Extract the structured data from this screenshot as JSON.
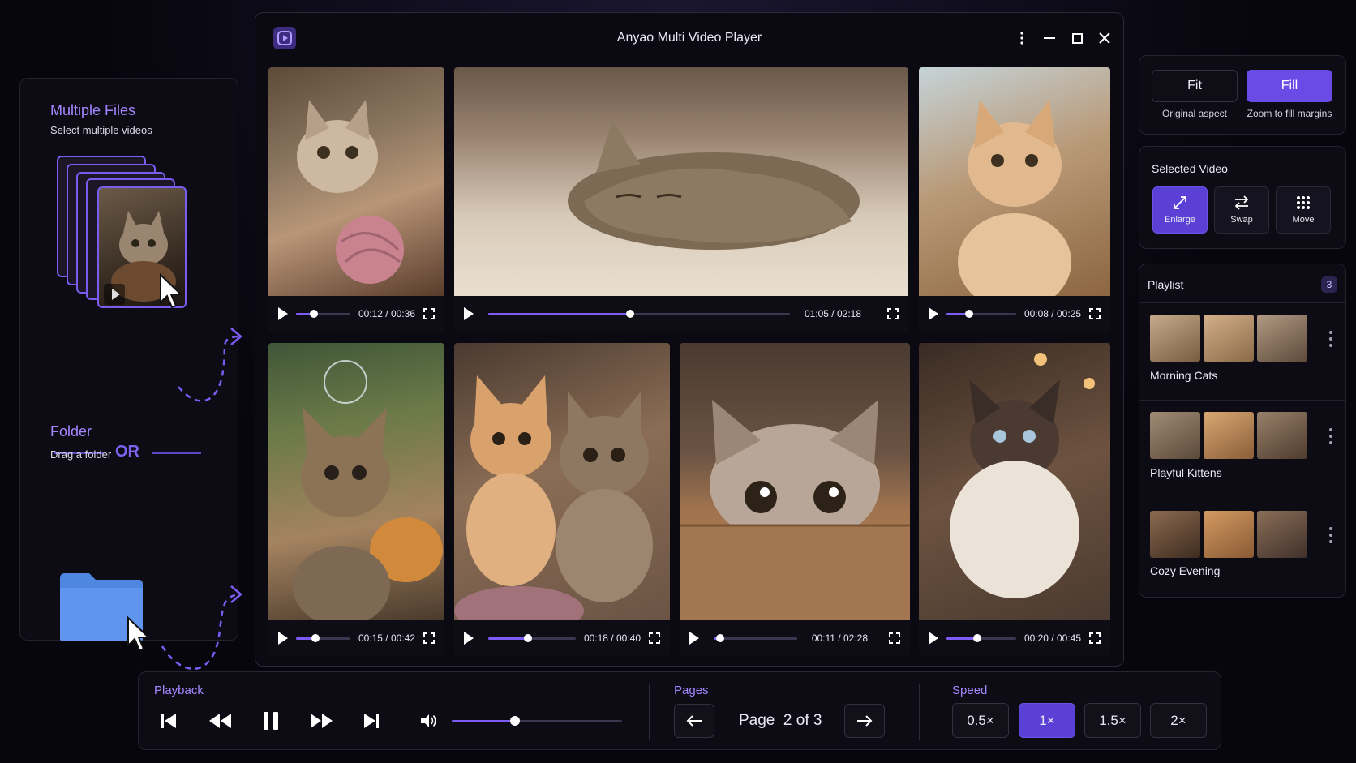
{
  "left": {
    "files_title": "Multiple Files",
    "files_sub": "Select multiple videos",
    "or": "OR",
    "folder_title": "Folder",
    "folder_sub": "Drag a folder"
  },
  "window": {
    "title": "Anyao Multi Video Player"
  },
  "videos": [
    {
      "time": "00:12 / 00:36",
      "progress": 0.33
    },
    {
      "time": "01:05 / 02:18",
      "progress": 0.47
    },
    {
      "time": "00:08 / 00:25",
      "progress": 0.32
    },
    {
      "time": "00:15 / 00:42",
      "progress": 0.36
    },
    {
      "time": "00:18 / 00:40",
      "progress": 0.45
    },
    {
      "time": "00:11 / 02:28",
      "progress": 0.08
    },
    {
      "time": "00:20 / 00:45",
      "progress": 0.44
    }
  ],
  "fit": {
    "fit_label": "Fit",
    "fit_caption": "Original aspect",
    "fill_label": "Fill",
    "fill_caption": "Zoom to fill margins"
  },
  "selected": {
    "title": "Selected Video",
    "enlarge": "Enlarge",
    "swap": "Swap",
    "move": "Move"
  },
  "playlist": {
    "title": "Playlist",
    "count": "3",
    "items": [
      {
        "name": "Morning Cats"
      },
      {
        "name": "Playful Kittens"
      },
      {
        "name": "Cozy Evening"
      }
    ]
  },
  "bottom": {
    "playback_label": "Playback",
    "volume": 0.37,
    "pages_label": "Pages",
    "page_text": "Page  2 of 3",
    "speed_label": "Speed",
    "speeds": [
      "0.5×",
      "1×",
      "1.5×",
      "2×"
    ],
    "active_speed": "1×"
  },
  "colors": {
    "accent": "#7c5cf5",
    "accent_text": "#a487ff",
    "active_button": "#5b40d6"
  }
}
